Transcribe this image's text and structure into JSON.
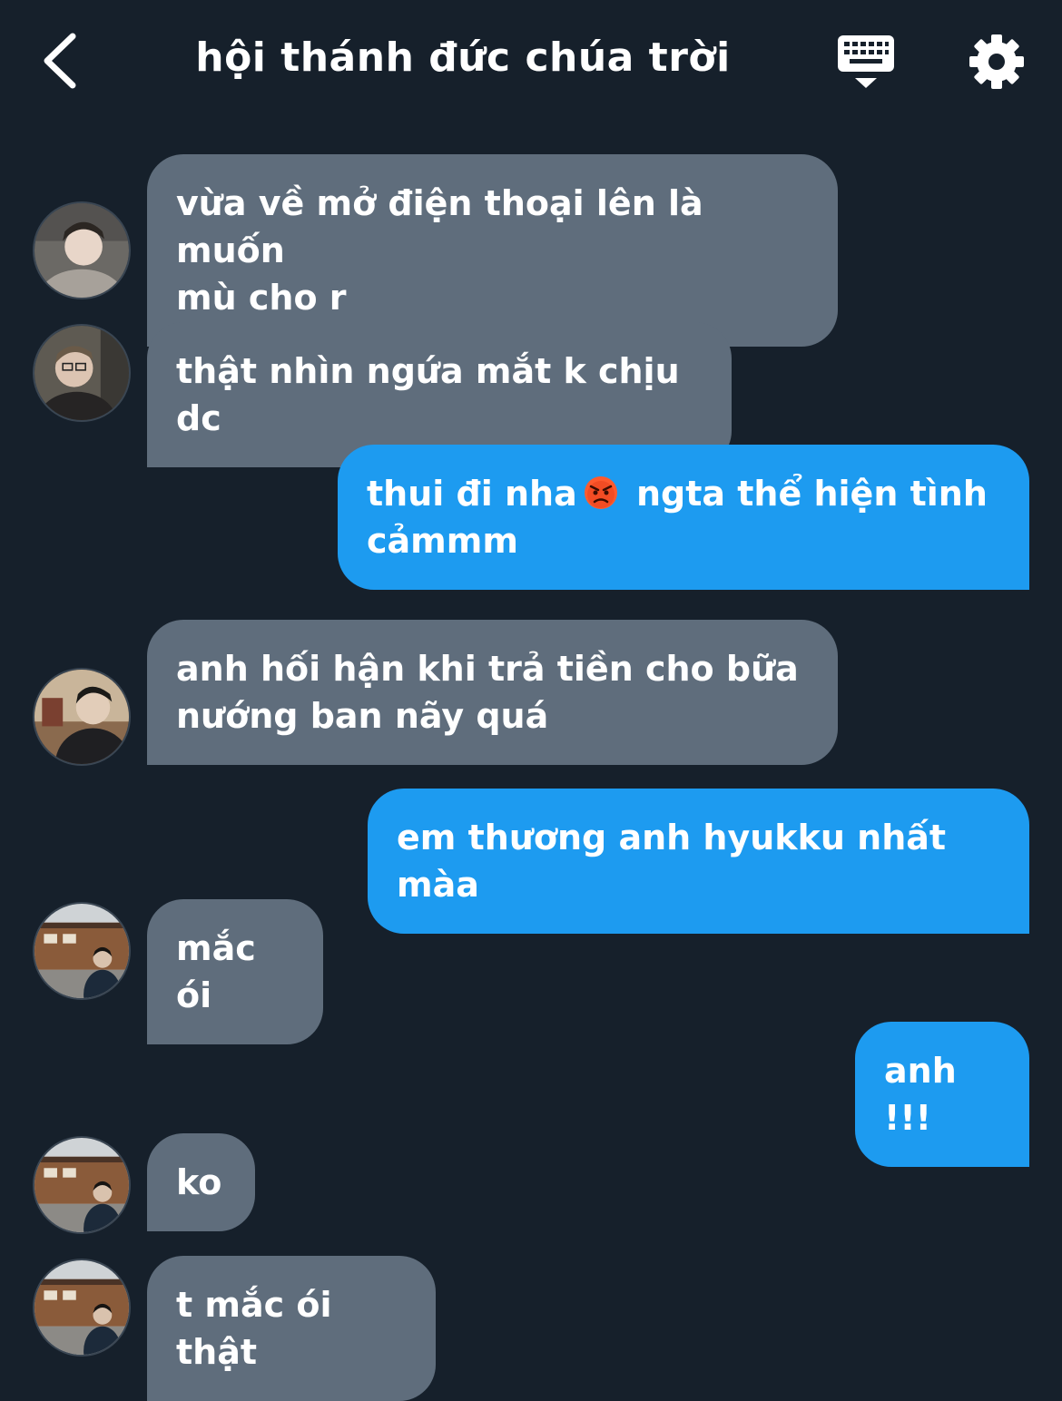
{
  "header": {
    "title": "hội thánh đức chúa trời",
    "back_icon": "chevron-left-icon",
    "keyboard_icon": "keyboard-icon",
    "settings_icon": "gear-icon"
  },
  "colors": {
    "background": "#16202b",
    "incoming_bubble": "#5f6d7c",
    "outgoing_bubble": "#1d9bf0",
    "text": "#ffffff"
  },
  "messages": [
    {
      "side": "in",
      "text": "vừa về mở điện thoại lên là muốn\nmù cho r"
    },
    {
      "side": "in",
      "text": "thật nhìn ngứa mắt k chịu dc"
    },
    {
      "side": "out",
      "text_before_emoji": "thui đi nha",
      "emoji": "angry-face-emoji",
      "text_after_emoji": " ngta thể hiện tình\ncảmmm"
    },
    {
      "side": "in",
      "text": "anh hối hận khi trả tiền cho bữa\nnướng ban nãy quá"
    },
    {
      "side": "out",
      "text": "em thương anh hyukku nhất màa"
    },
    {
      "side": "in",
      "text": "mắc ói"
    },
    {
      "side": "out",
      "text": "anh !!!"
    },
    {
      "side": "in",
      "text": " ko"
    },
    {
      "side": "in",
      "text": "t mắc ói thật"
    }
  ]
}
